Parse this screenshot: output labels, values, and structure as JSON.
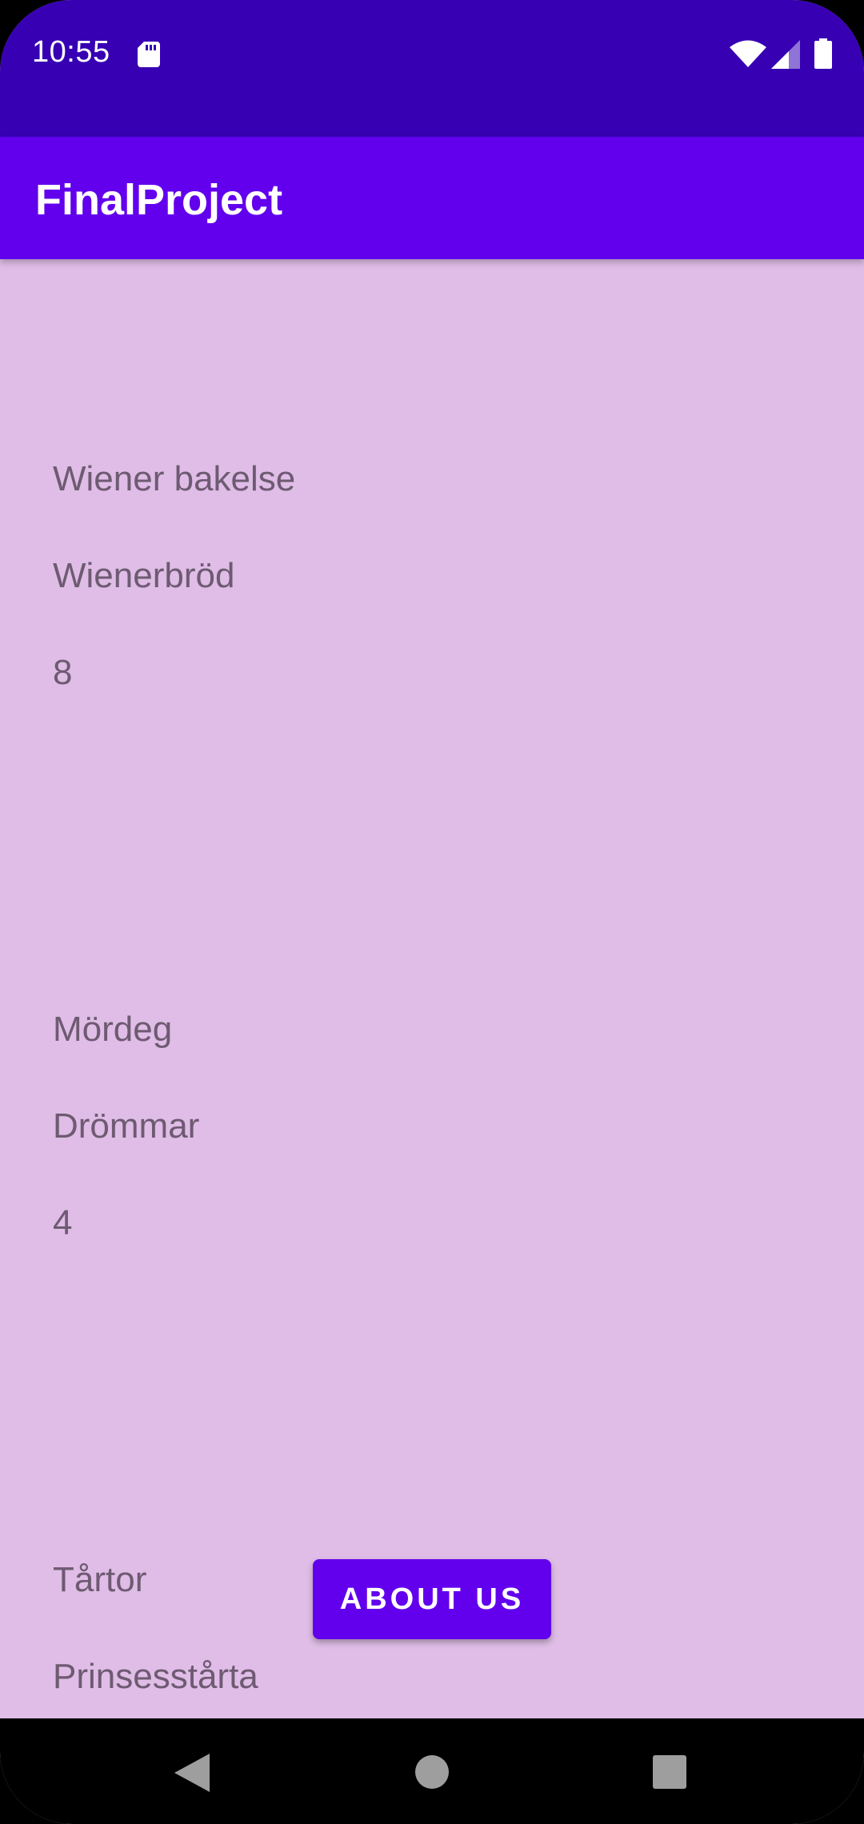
{
  "status_bar": {
    "time": "10:55",
    "icons": [
      "sd-card-icon",
      "wifi-icon",
      "signal-icon",
      "battery-icon"
    ]
  },
  "app_bar": {
    "title": "FinalProject"
  },
  "list": {
    "items": [
      {
        "category": "Wiener bakelse",
        "name": "Wienerbröd",
        "quantity": "8"
      },
      {
        "category": "Mördeg",
        "name": "Drömmar",
        "quantity": "4"
      },
      {
        "category": "Tårtor",
        "name": "Prinsesstårta"
      }
    ]
  },
  "about_button": {
    "label": "ABOUT US"
  },
  "nav_bar": {
    "icons": [
      "back-icon",
      "home-icon",
      "recents-icon"
    ]
  },
  "colors": {
    "status_bar": "#3700b3",
    "app_bar": "#6200ee",
    "background": "#dfbde6",
    "text": "#6e5a72",
    "button": "#6200ee"
  }
}
